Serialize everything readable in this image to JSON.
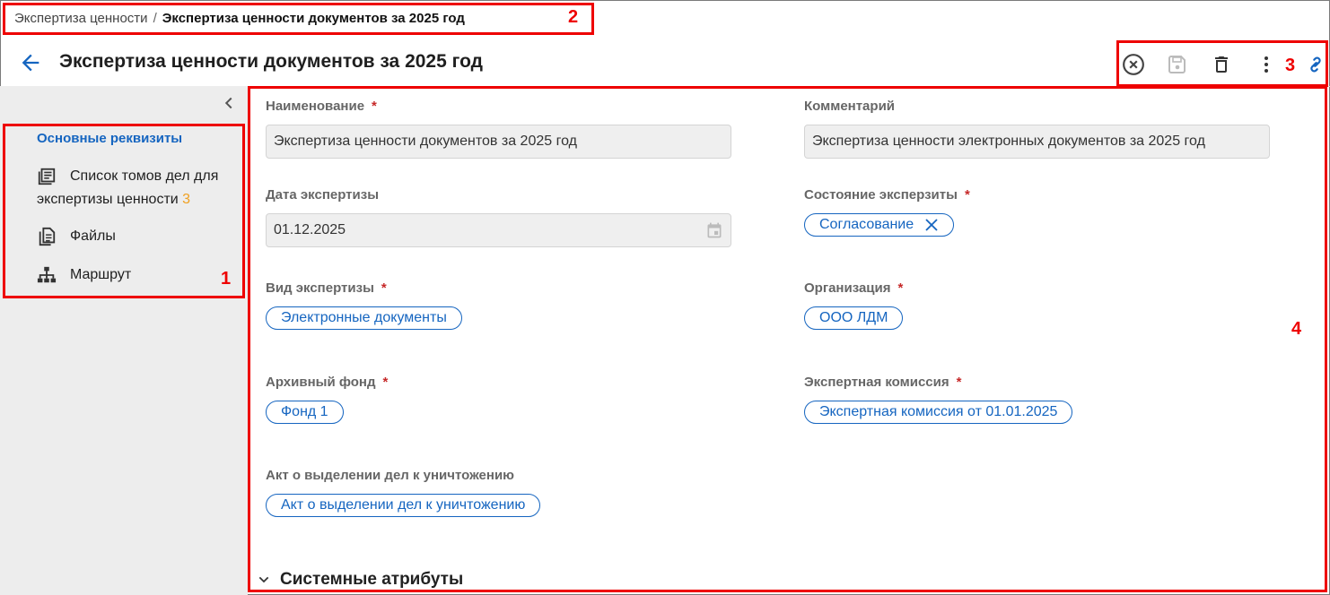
{
  "breadcrumb": {
    "parent": "Экспертиза ценности",
    "separator": "/",
    "current": "Экспертиза ценности документов за 2025 год"
  },
  "header": {
    "title": "Экспертиза ценности документов за 2025 год"
  },
  "sidebar": {
    "active_item": "Основные реквизиты",
    "items": [
      {
        "line1": "Список томов дел для",
        "line2": "экспертизы ценности",
        "count": "3",
        "icon": "list-icon"
      },
      {
        "label": "Файлы",
        "icon": "files-icon"
      },
      {
        "label": "Маршрут",
        "icon": "route-icon"
      }
    ]
  },
  "form": {
    "name": {
      "label": "Наименование",
      "required": "*",
      "value": "Экспертиза ценности документов за 2025 год"
    },
    "comment": {
      "label": "Комментарий",
      "value": "Экспертиза ценности электронных документов за 2025 год"
    },
    "date": {
      "label": "Дата экспертизы",
      "value": "01.12.2025"
    },
    "state": {
      "label": "Состояние экспертизы",
      "label_display": "Состояние эксперзиты",
      "required": "*",
      "value": "Согласование"
    },
    "kind": {
      "label": "Вид экспертизы",
      "required": "*",
      "value": "Электронные документы"
    },
    "organization": {
      "label": "Организация",
      "required": "*",
      "value": "ООО ЛДМ"
    },
    "fund": {
      "label": "Архивный фонд",
      "required": "*",
      "value": "Фонд 1"
    },
    "commission": {
      "label": "Экспертная комиссия",
      "required": "*",
      "value": "Экспертная комиссия от 01.01.2025"
    },
    "act": {
      "label": "Акт о выделении дел к уничтожению",
      "value": "Акт о выделении дел к уничтожению"
    }
  },
  "system_section": {
    "label": "Системные атрибуты"
  },
  "annotations": {
    "n1": "1",
    "n2": "2",
    "n3": "3",
    "n4": "4"
  },
  "colors": {
    "accent": "#1565c0",
    "annotation": "#e00000",
    "count": "#f0a020"
  }
}
